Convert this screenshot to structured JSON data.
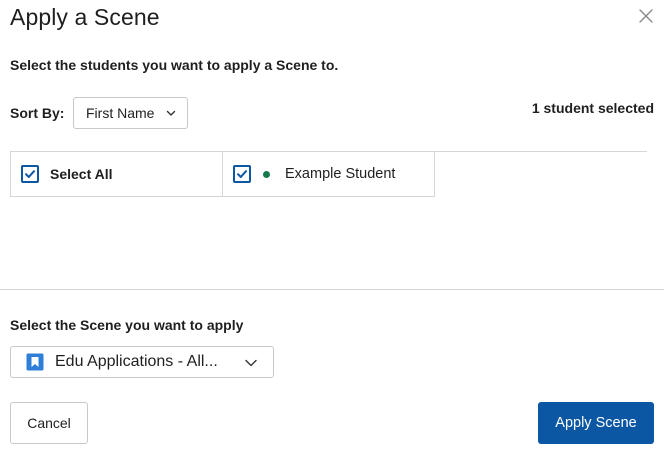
{
  "dialog": {
    "title": "Apply a Scene",
    "close_icon": "close-icon"
  },
  "students_section": {
    "instruction": "Select the students you want to apply a Scene to.",
    "sort_label": "Sort By:",
    "sort_value": "First Name",
    "selected_count": "1 student selected",
    "select_all_label": "Select All",
    "select_all_checked": true,
    "students": [
      {
        "name": "Example Student",
        "checked": true,
        "status": "online",
        "status_color": "#137a4a"
      }
    ]
  },
  "scene_section": {
    "label": "Select the Scene you want to apply",
    "selected_scene": "Edu Applications - All...",
    "scene_icon": "bookmark-icon",
    "scene_icon_color": "#2f7fd8"
  },
  "footer": {
    "cancel_label": "Cancel",
    "apply_label": "Apply Scene"
  },
  "colors": {
    "primary": "#0b57a4",
    "border": "#d6d6d6"
  }
}
